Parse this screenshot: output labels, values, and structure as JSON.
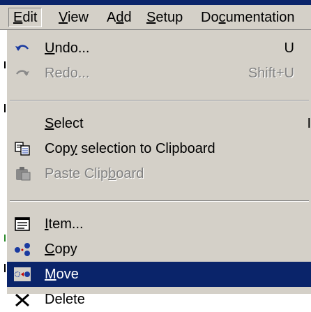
{
  "menubar": {
    "items": [
      {
        "pre": "",
        "u": "E",
        "post": "dit"
      },
      {
        "pre": "",
        "u": "V",
        "post": "iew"
      },
      {
        "pre": "A",
        "u": "d",
        "post": "d"
      },
      {
        "pre": "",
        "u": "S",
        "post": "etup"
      },
      {
        "pre": "Do",
        "u": "c",
        "post": "umentation"
      }
    ]
  },
  "menu": {
    "undo": {
      "pre": "",
      "u": "U",
      "post": "ndo...",
      "shortcut": "U"
    },
    "redo": {
      "text": "Redo...",
      "shortcut": "Shift+U"
    },
    "select": {
      "pre": "",
      "u": "S",
      "post": "elect",
      "shortcut": "I"
    },
    "copy_sel": {
      "pre": "Cop",
      "u": "y",
      "post": " selection to Clipboard"
    },
    "paste": {
      "pre": "Paste Clip",
      "u": "b",
      "post": "oard"
    },
    "item": {
      "pre": "",
      "u": "I",
      "post": "tem..."
    },
    "copy": {
      "pre": "",
      "u": "C",
      "post": "opy"
    },
    "move": {
      "pre": "",
      "u": "M",
      "post": "ove"
    },
    "delete": {
      "text": "Delete"
    }
  },
  "colors": {
    "highlight": "#0a246a",
    "menu_bg": "#d4d0c8",
    "disabled": "#808080"
  }
}
